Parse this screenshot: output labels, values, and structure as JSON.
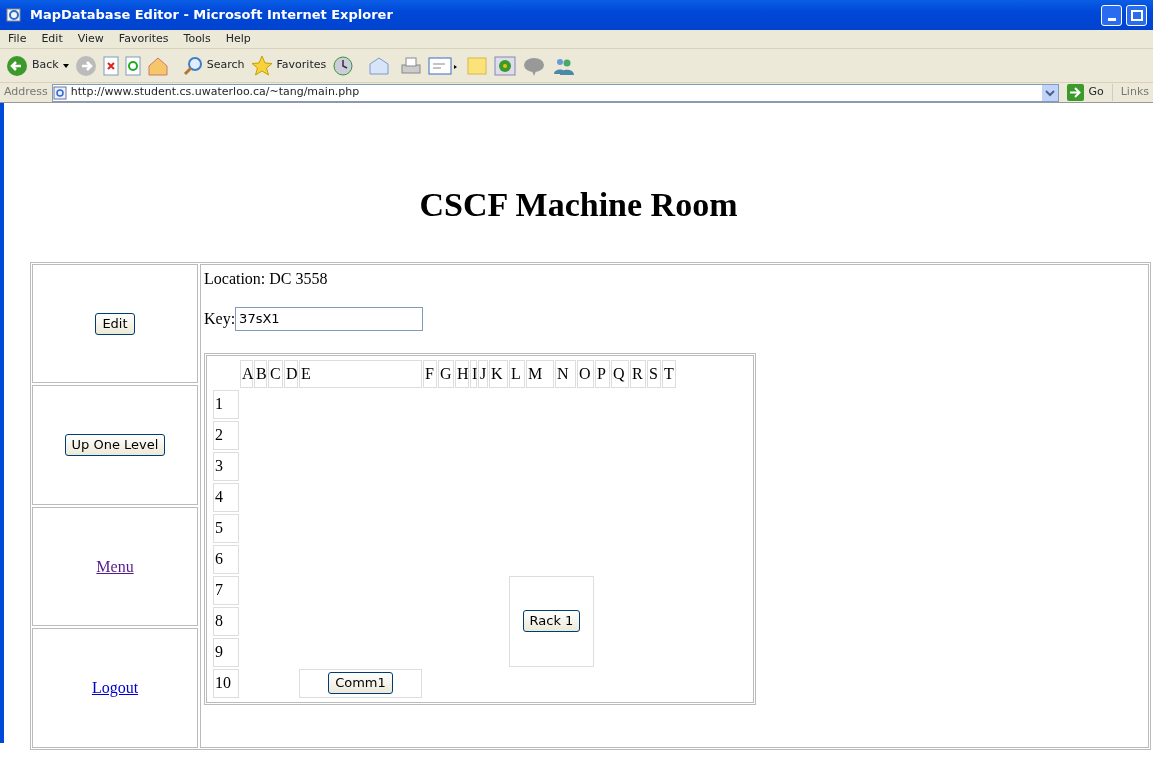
{
  "window": {
    "title": "MapDatabase Editor - Microsoft Internet Explorer"
  },
  "menu_bar": [
    "File",
    "Edit",
    "View",
    "Favorites",
    "Tools",
    "Help"
  ],
  "toolbar": [
    {
      "label": "Back"
    },
    {
      "label": "Search"
    },
    {
      "label": "Favorites"
    }
  ],
  "address_bar": {
    "label": "Address",
    "url": "http://www.student.cs.uwaterloo.ca/~tang/main.php",
    "go": "Go",
    "links": "Links"
  },
  "page": {
    "heading": "CSCF Machine Room",
    "sidebar": [
      {
        "kind": "button",
        "label": "Edit"
      },
      {
        "kind": "button",
        "label": "Up One Level"
      },
      {
        "kind": "link",
        "label": "Menu",
        "visited": true
      },
      {
        "kind": "link",
        "label": "Logout",
        "visited": false
      }
    ],
    "location": "Location: DC 3558",
    "key": {
      "label": "Key:",
      "value": "37sX1"
    },
    "map": {
      "columns": [
        "A",
        "B",
        "C",
        "D",
        "E",
        "F",
        "G",
        "H",
        "I",
        "J",
        "K",
        "L",
        "M",
        "N",
        "O",
        "P",
        "Q",
        "R",
        "S",
        "T"
      ],
      "rows": [
        "1",
        "2",
        "3",
        "4",
        "5",
        "6",
        "7",
        "8",
        "9",
        "10"
      ],
      "items": [
        {
          "label": "Rack 1"
        },
        {
          "label": "Comm1"
        }
      ]
    }
  }
}
